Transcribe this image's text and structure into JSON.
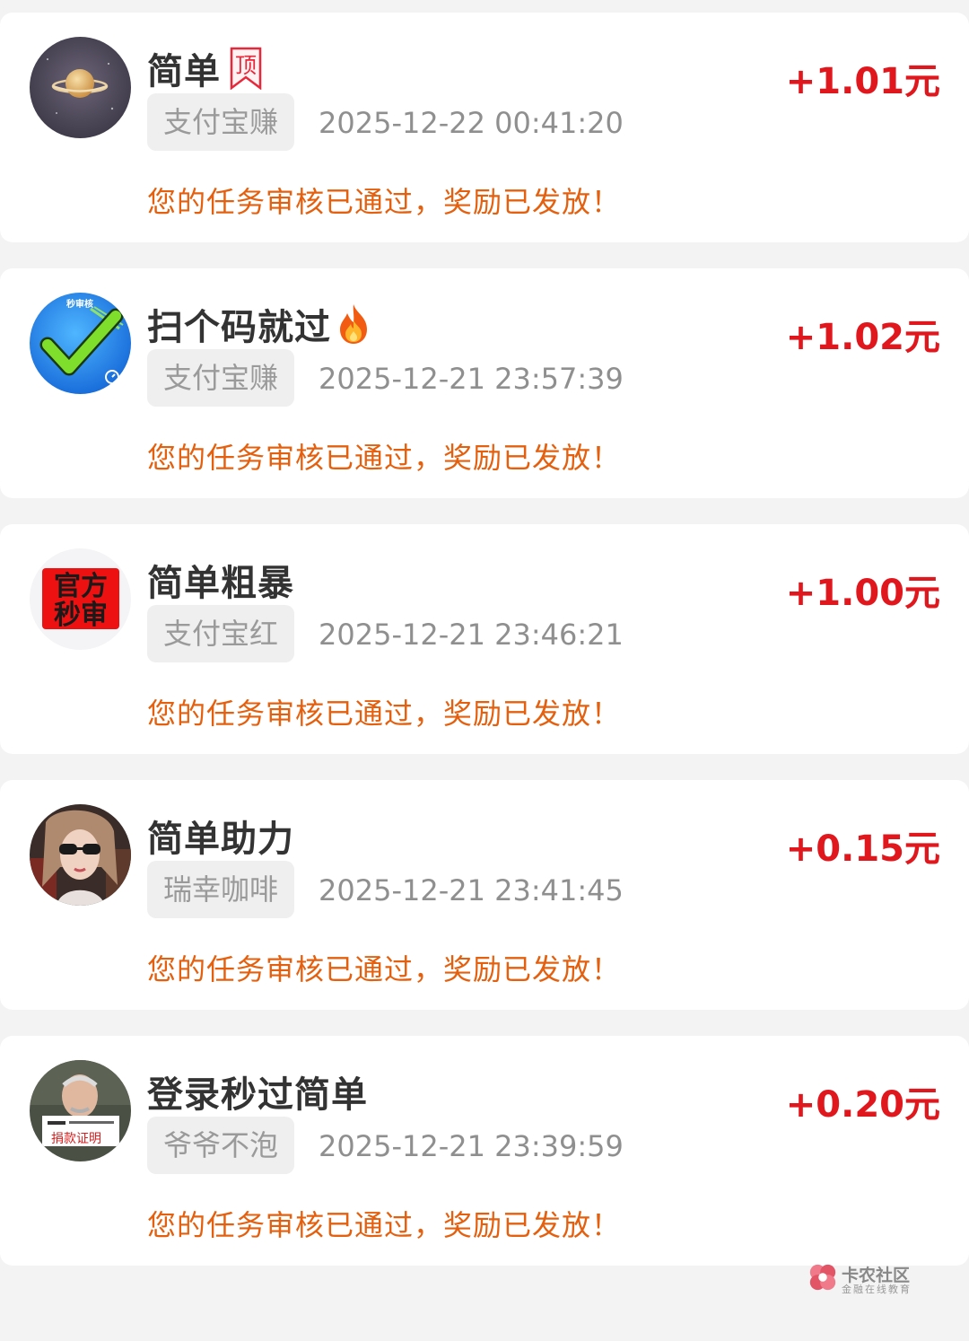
{
  "colors": {
    "amount": "#e0181e",
    "status": "#e4600e",
    "tag_bg": "#efefef"
  },
  "tasks": [
    {
      "title": "简单",
      "badge": "顶",
      "badge_icon": "pin-badge-icon",
      "amount": "+1.01元",
      "tag": "支付宝赚",
      "time": "2025-12-22 00:41:20",
      "status": "您的任务审核已通过，奖励已发放！",
      "avatar_icon": "planet-avatar"
    },
    {
      "title": "扫个码就过",
      "title_icon": "fire-icon",
      "amount": "+1.02元",
      "tag": "支付宝赚",
      "time": "2025-12-21 23:57:39",
      "status": "您的任务审核已通过，奖励已发放！",
      "avatar_icon": "checkmark-avatar",
      "avatar_text": "秒审核"
    },
    {
      "title": "简单粗暴",
      "amount": "+1.00元",
      "tag": "支付宝红",
      "time": "2025-12-21 23:46:21",
      "status": "您的任务审核已通过，奖励已发放！",
      "avatar_icon": "stamp-avatar",
      "avatar_text_line1": "官方",
      "avatar_text_line2": "秒审"
    },
    {
      "title": "简单助力",
      "amount": "+0.15元",
      "tag": "瑞幸咖啡",
      "time": "2025-12-21 23:41:45",
      "status": "您的任务审核已通过，奖励已发放！",
      "avatar_icon": "woman-sunglasses-avatar"
    },
    {
      "title": "登录秒过简单",
      "amount": "+0.20元",
      "tag": "爷爷不泡",
      "time": "2025-12-21 23:39:59",
      "status": "您的任务审核已通过，奖励已发放！",
      "avatar_icon": "old-man-avatar",
      "avatar_text": "捐款证明"
    }
  ],
  "watermark": {
    "title": "卡农社区",
    "subtitle": "金融在线教育"
  }
}
